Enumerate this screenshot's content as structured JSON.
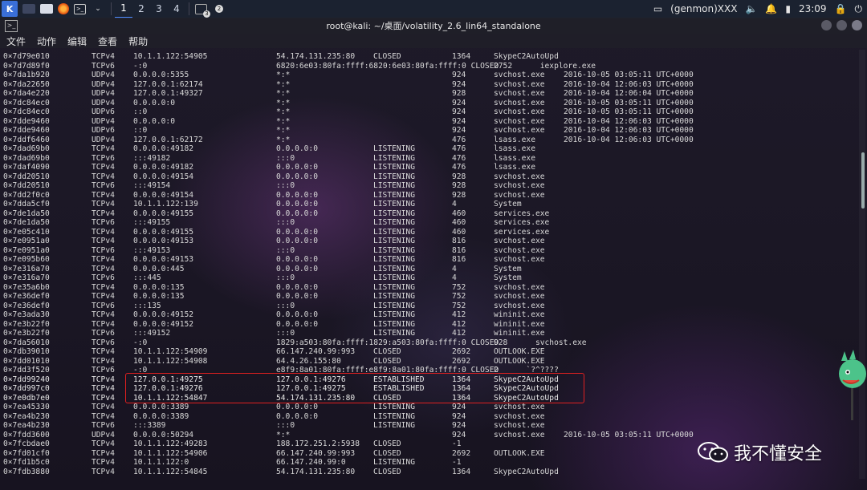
{
  "taskbar": {
    "workspaces": [
      "1",
      "2",
      "3",
      "4"
    ],
    "active_workspace": "1",
    "notif_badges": [
      "3",
      "2"
    ],
    "user": "(genmon)XXX",
    "time": "23:09"
  },
  "window": {
    "title": "root@kali: ~/桌面/volatility_2.6_lin64_standalone",
    "menu": [
      "文件",
      "动作",
      "编辑",
      "查看",
      "帮助"
    ]
  },
  "rows": [
    [
      "0×7d79e010",
      "TCPv4",
      "10.1.1.122:54905",
      "54.174.131.235:80",
      "CLOSED",
      "1364",
      "SkypeC2AutoUpd",
      ""
    ],
    [
      "0×7d7d89f0",
      "TCPv6",
      "-:0",
      "6820:6e03:80fa:ffff:6820:6e03:80fa:ffff:0 CLOSED",
      "",
      "",
      "2752      iexplore.exe",
      ""
    ],
    [
      "0×7da1b920",
      "UDPv4",
      "0.0.0.0:5355",
      "*:*",
      "",
      "924",
      "svchost.exe",
      "2016-10-05 03:05:11 UTC+0000"
    ],
    [
      "0×7da22650",
      "UDPv4",
      "127.0.0.1:62174",
      "*:*",
      "",
      "924",
      "svchost.exe",
      "2016-10-04 12:06:03 UTC+0000"
    ],
    [
      "0×7da4e220",
      "UDPv4",
      "127.0.0.1:49327",
      "*:*",
      "",
      "928",
      "svchost.exe",
      "2016-10-04 12:06:04 UTC+0000"
    ],
    [
      "0×7dc84ec0",
      "UDPv4",
      "0.0.0.0:0",
      "*:*",
      "",
      "924",
      "svchost.exe",
      "2016-10-05 03:05:11 UTC+0000"
    ],
    [
      "0×7dc84ec0",
      "UDPv6",
      "::0",
      "*:*",
      "",
      "924",
      "svchost.exe",
      "2016-10-05 03:05:11 UTC+0000"
    ],
    [
      "0×7dde9460",
      "UDPv4",
      "0.0.0.0:0",
      "*:*",
      "",
      "924",
      "svchost.exe",
      "2016-10-04 12:06:03 UTC+0000"
    ],
    [
      "0×7dde9460",
      "UDPv6",
      "::0",
      "*:*",
      "",
      "924",
      "svchost.exe",
      "2016-10-04 12:06:03 UTC+0000"
    ],
    [
      "0×7ddf6460",
      "UDPv4",
      "127.0.0.1:62172",
      "*:*",
      "",
      "476",
      "lsass.exe",
      "2016-10-04 12:06:03 UTC+0000"
    ],
    [
      "0×7dad69b0",
      "TCPv4",
      "0.0.0.0:49182",
      "0.0.0.0:0",
      "LISTENING",
      "476",
      "lsass.exe",
      ""
    ],
    [
      "0×7dad69b0",
      "TCPv6",
      ":::49182",
      ":::0",
      "LISTENING",
      "476",
      "lsass.exe",
      ""
    ],
    [
      "0×7daf4090",
      "TCPv4",
      "0.0.0.0:49182",
      "0.0.0.0:0",
      "LISTENING",
      "476",
      "lsass.exe",
      ""
    ],
    [
      "0×7dd20510",
      "TCPv4",
      "0.0.0.0:49154",
      "0.0.0.0:0",
      "LISTENING",
      "928",
      "svchost.exe",
      ""
    ],
    [
      "0×7dd20510",
      "TCPv6",
      ":::49154",
      ":::0",
      "LISTENING",
      "928",
      "svchost.exe",
      ""
    ],
    [
      "0×7dd2f0c0",
      "TCPv4",
      "0.0.0.0:49154",
      "0.0.0.0:0",
      "LISTENING",
      "928",
      "svchost.exe",
      ""
    ],
    [
      "0×7dda5cf0",
      "TCPv4",
      "10.1.1.122:139",
      "0.0.0.0:0",
      "LISTENING",
      "4",
      "System",
      ""
    ],
    [
      "0×7de1da50",
      "TCPv4",
      "0.0.0.0:49155",
      "0.0.0.0:0",
      "LISTENING",
      "460",
      "services.exe",
      ""
    ],
    [
      "0×7de1da50",
      "TCPv6",
      ":::49155",
      ":::0",
      "LISTENING",
      "460",
      "services.exe",
      ""
    ],
    [
      "0×7e05c410",
      "TCPv4",
      "0.0.0.0:49155",
      "0.0.0.0:0",
      "LISTENING",
      "460",
      "services.exe",
      ""
    ],
    [
      "0×7e0951a0",
      "TCPv4",
      "0.0.0.0:49153",
      "0.0.0.0:0",
      "LISTENING",
      "816",
      "svchost.exe",
      ""
    ],
    [
      "0×7e0951a0",
      "TCPv6",
      ":::49153",
      ":::0",
      "LISTENING",
      "816",
      "svchost.exe",
      ""
    ],
    [
      "0×7e095b60",
      "TCPv4",
      "0.0.0.0:49153",
      "0.0.0.0:0",
      "LISTENING",
      "816",
      "svchost.exe",
      ""
    ],
    [
      "0×7e316a70",
      "TCPv4",
      "0.0.0.0:445",
      "0.0.0.0:0",
      "LISTENING",
      "4",
      "System",
      ""
    ],
    [
      "0×7e316a70",
      "TCPv6",
      ":::445",
      ":::0",
      "LISTENING",
      "4",
      "System",
      ""
    ],
    [
      "0×7e35a6b0",
      "TCPv4",
      "0.0.0.0:135",
      "0.0.0.0:0",
      "LISTENING",
      "752",
      "svchost.exe",
      ""
    ],
    [
      "0×7e36def0",
      "TCPv4",
      "0.0.0.0:135",
      "0.0.0.0:0",
      "LISTENING",
      "752",
      "svchost.exe",
      ""
    ],
    [
      "0×7e36def0",
      "TCPv6",
      ":::135",
      ":::0",
      "LISTENING",
      "752",
      "svchost.exe",
      ""
    ],
    [
      "0×7e3ada30",
      "TCPv4",
      "0.0.0.0:49152",
      "0.0.0.0:0",
      "LISTENING",
      "412",
      "wininit.exe",
      ""
    ],
    [
      "0×7e3b22f0",
      "TCPv4",
      "0.0.0.0:49152",
      "0.0.0.0:0",
      "LISTENING",
      "412",
      "wininit.exe",
      ""
    ],
    [
      "0×7e3b22f0",
      "TCPv6",
      ":::49152",
      ":::0",
      "LISTENING",
      "412",
      "wininit.exe",
      ""
    ],
    [
      "0×7da56010",
      "TCPv6",
      "-:0",
      "1829:a503:80fa:ffff:1829:a503:80fa:ffff:0 CLOSED",
      "",
      "",
      "928      svchost.exe",
      ""
    ],
    [
      "0×7db39010",
      "TCPv4",
      "10.1.1.122:54909",
      "66.147.240.99:993",
      "CLOSED",
      "2692",
      "OUTLOOK.EXE",
      ""
    ],
    [
      "0×7dd01010",
      "TCPv4",
      "10.1.1.122:54908",
      "64.4.26.155:80",
      "CLOSED",
      "2692",
      "OUTLOOK.EXE",
      ""
    ],
    [
      "0×7dd3f520",
      "TCPv6",
      "-:0",
      "e8f9:8a01:80fa:ffff:e8f9:8a01:80fa:ffff:0 CLOSED",
      "",
      "",
      "2      `?^????",
      ""
    ],
    [
      "0×7dd99240",
      "TCPv4",
      "127.0.0.1:49275",
      "127.0.0.1:49276",
      "ESTABLISHED",
      "1364",
      "SkypeC2AutoUpd",
      ""
    ],
    [
      "0×7dd997c0",
      "TCPv4",
      "127.0.0.1:49276",
      "127.0.0.1:49275",
      "ESTABLISHED",
      "1364",
      "SkypeC2AutoUpd",
      ""
    ],
    [
      "0×7e0db7e0",
      "TCPv4",
      "10.1.1.122:54847",
      "54.174.131.235:80",
      "CLOSED",
      "1364",
      "SkypeC2AutoUpd",
      ""
    ],
    [
      "0×7ea45330",
      "TCPv4",
      "0.0.0.0:3389",
      "0.0.0.0:0",
      "LISTENING",
      "924",
      "svchost.exe",
      ""
    ],
    [
      "0×7ea4b230",
      "TCPv4",
      "0.0.0.0:3389",
      "0.0.0.0:0",
      "LISTENING",
      "924",
      "svchost.exe",
      ""
    ],
    [
      "0×7ea4b230",
      "TCPv6",
      ":::3389",
      ":::0",
      "LISTENING",
      "924",
      "svchost.exe",
      ""
    ],
    [
      "0×7fdd3600",
      "UDPv4",
      "0.0.0.0:50294",
      "*:*",
      "",
      "924",
      "svchost.exe",
      "2016-10-05 03:05:11 UTC+0000"
    ],
    [
      "0×7fcbdae0",
      "TCPv4",
      "10.1.1.122:49283",
      "188.172.251.2:5938",
      "CLOSED",
      "-1",
      "",
      ""
    ],
    [
      "0×7fd01cf0",
      "TCPv4",
      "10.1.1.122:54906",
      "66.147.240.99:993",
      "CLOSED",
      "2692",
      "OUTLOOK.EXE",
      ""
    ],
    [
      "0×7fd1b5c0",
      "TCPv4",
      "10.1.1.122:0",
      "66.147.240.99:0",
      "LISTENING",
      "-1",
      "",
      ""
    ],
    [
      "0×7fdb3880",
      "TCPv4",
      "10.1.1.122:54845",
      "54.174.131.235:80",
      "CLOSED",
      "1364",
      "SkypeC2AutoUpd",
      ""
    ]
  ],
  "highlighted_rows": [
    35,
    36,
    37
  ],
  "watermark": "我不懂安全",
  "colors": {
    "highlight": "#e02020",
    "terminal_text": "#d8d8d8"
  }
}
